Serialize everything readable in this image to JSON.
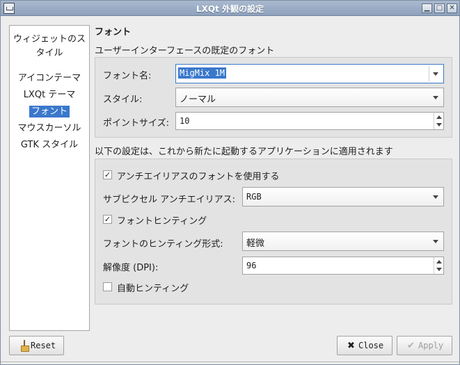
{
  "window": {
    "title": "LXQt 外観の設定",
    "controls": {
      "minimize": "▁",
      "maximize": "□",
      "close": "✕"
    }
  },
  "sidebar": {
    "items": [
      {
        "label": "ウィジェットのスタイル",
        "selected": false
      },
      {
        "label": "アイコンテーマ",
        "selected": false
      },
      {
        "label": "LXQt テーマ",
        "selected": false
      },
      {
        "label": "フォント",
        "selected": true
      },
      {
        "label": "マウスカーソル",
        "selected": false
      },
      {
        "label": "GTK スタイル",
        "selected": false
      }
    ]
  },
  "page": {
    "title": "フォント",
    "default_font_section": "ユーザーインターフェースの既定のフォント",
    "font_name_label": "フォント名:",
    "font_name_value": "MigMix 1M",
    "style_label": "スタイル:",
    "style_value": "ノーマル",
    "point_size_label": "ポイントサイズ:",
    "point_size_value": "10",
    "apply_note": "以下の設定は、これから新たに起動するアプリケーションに適用されます",
    "antialias_label": "アンチエイリアスのフォントを使用する",
    "antialias_checked": true,
    "subpixel_label": "サブピクセル アンチエイリアス:",
    "subpixel_value": "RGB",
    "hinting_label": "フォントヒンティング",
    "hinting_checked": true,
    "hint_style_label": "フォントのヒンティング形式:",
    "hint_style_value": "軽微",
    "dpi_label": "解像度 (DPI):",
    "dpi_value": "96",
    "autohint_label": "自動ヒンティング",
    "autohint_checked": false
  },
  "buttons": {
    "reset": "Reset",
    "close": "Close",
    "apply": "Apply"
  },
  "icons": {
    "close_glyph": "✖",
    "apply_glyph": "✔",
    "check_glyph": "✓"
  },
  "colors": {
    "selection": "#3a78cc",
    "titlebar": "#98aac2"
  }
}
